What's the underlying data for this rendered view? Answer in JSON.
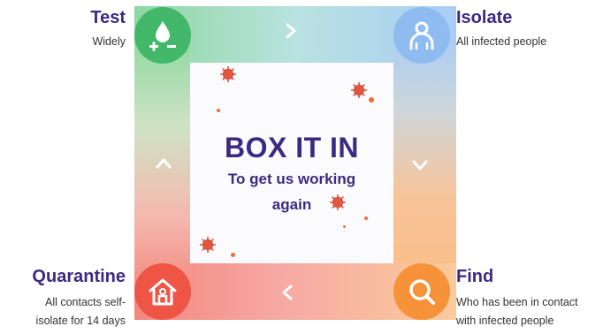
{
  "center": {
    "headline": "BOX IT IN",
    "subline": "To get us working again"
  },
  "steps": {
    "test": {
      "title": "Test",
      "description": "Widely",
      "icon": "blood-drop-plus-minus-icon",
      "color": "#43b86b"
    },
    "isolate": {
      "title": "Isolate",
      "description": "All infected people",
      "icon": "person-icon",
      "color": "#8ebcf1"
    },
    "find": {
      "title": "Find",
      "description_line1": "Who has been in contact",
      "description_line2": "with infected people",
      "icon": "magnifier-icon",
      "color": "#f6923a"
    },
    "quarantine": {
      "title": "Quarantine",
      "description_line1": "All contacts self-",
      "description_line2": "isolate for 14 days",
      "icon": "house-icon",
      "color": "#ef5545"
    }
  },
  "arrows": {
    "top": ">",
    "right": "v",
    "bottom": "<",
    "left": "^"
  },
  "colors": {
    "text_primary": "#3b2a82",
    "virus": "#e2563a"
  }
}
